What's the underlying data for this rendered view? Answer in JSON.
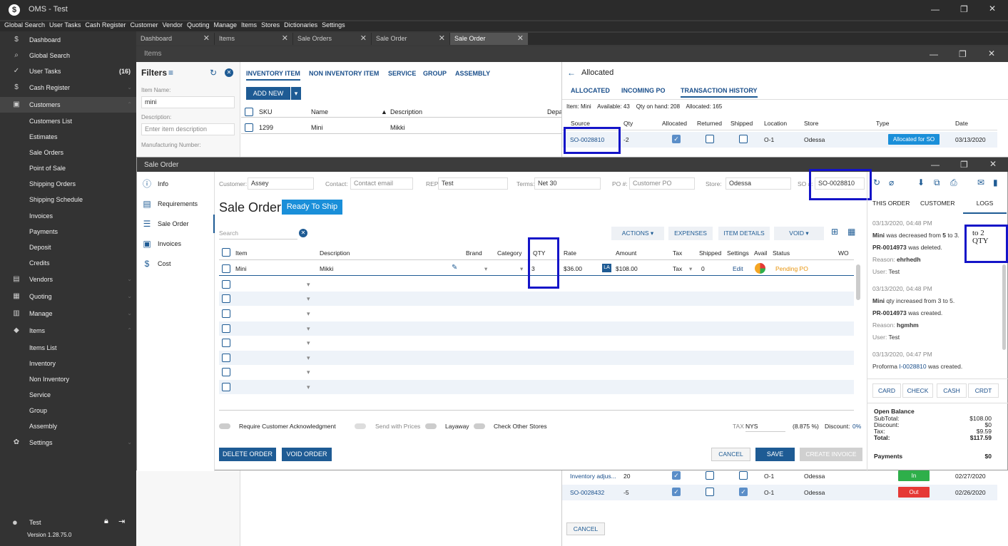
{
  "app": {
    "title": "OMS - Test",
    "logo": "$"
  },
  "menu": [
    "Global Search",
    "User Tasks",
    "Cash Register",
    "Customer",
    "Vendor",
    "Quoting",
    "Manage",
    "Items",
    "Stores",
    "Dictionaries",
    "Settings"
  ],
  "sidebar": {
    "items": [
      {
        "label": "Dashboard",
        "icon": "$"
      },
      {
        "label": "Global Search",
        "icon": "⌕"
      },
      {
        "label": "User Tasks",
        "icon": "✓",
        "count": "(16)"
      },
      {
        "label": "Cash Register",
        "icon": "$"
      },
      {
        "label": "Customers",
        "icon": "▣"
      },
      {
        "label": "Customers List"
      },
      {
        "label": "Estimates"
      },
      {
        "label": "Sale Orders"
      },
      {
        "label": "Point of Sale"
      },
      {
        "label": "Shipping Orders"
      },
      {
        "label": "Shipping Schedule"
      },
      {
        "label": "Invoices"
      },
      {
        "label": "Payments"
      },
      {
        "label": "Deposit"
      },
      {
        "label": "Credits"
      },
      {
        "label": "Vendors",
        "icon": "▤"
      },
      {
        "label": "Quoting",
        "icon": "▦"
      },
      {
        "label": "Manage",
        "icon": "▥"
      },
      {
        "label": "Items",
        "icon": "◆"
      },
      {
        "label": "Items List"
      },
      {
        "label": "Inventory"
      },
      {
        "label": "Non Inventory"
      },
      {
        "label": "Service"
      },
      {
        "label": "Group"
      },
      {
        "label": "Assembly"
      },
      {
        "label": "Settings",
        "icon": "✿"
      }
    ],
    "user": "Test",
    "version": "Version 1.28.75.0"
  },
  "tabs": [
    "Dashboard",
    "Items",
    "Sale Orders",
    "Sale Order",
    "Sale Order"
  ],
  "items_window": {
    "title": "Items",
    "filters": {
      "title": "Filters",
      "item_name_label": "Item Name:",
      "item_name_value": "mini",
      "description_label": "Description:",
      "description_placeholder": "Enter item description",
      "mfg_label": "Manufacturing Number:"
    },
    "type_tabs": [
      "INVENTORY ITEM",
      "NON INVENTORY ITEM",
      "SERVICE",
      "GROUP",
      "ASSEMBLY"
    ],
    "add_new": "ADD NEW",
    "columns": [
      "SKU",
      "Name",
      "Description",
      "Depa"
    ],
    "row": {
      "sku": "1299",
      "name": "Mini",
      "description": "Mikki"
    }
  },
  "allocated_window": {
    "title": "Allocated",
    "tabs": [
      "ALLOCATED",
      "INCOMING PO",
      "TRANSACTION HISTORY"
    ],
    "summary": {
      "item": "Item: Mini",
      "available": "Available: 43",
      "on_hand": "Qty on hand: 208",
      "allocated": "Allocated: 165"
    },
    "columns": [
      "Source",
      "Qty",
      "Allocated",
      "Returned",
      "Shipped",
      "Location",
      "Store",
      "Type",
      "Date"
    ],
    "rows": [
      {
        "source": "SO-0028810",
        "qty": "-2",
        "allocated": true,
        "returned": false,
        "shipped": false,
        "location": "O-1",
        "store": "Odessa",
        "type": "Allocated for SO",
        "date": "03/13/2020"
      },
      {
        "source": "Inventory adjus...",
        "qty": "20",
        "allocated": true,
        "returned": false,
        "shipped": false,
        "location": "O-1",
        "store": "Odessa",
        "type": "In",
        "date": "02/27/2020"
      },
      {
        "source": "SO-0028432",
        "qty": "-5",
        "allocated": true,
        "returned": false,
        "shipped": true,
        "location": "O-1",
        "store": "Odessa",
        "type": "Out",
        "date": "02/26/2020"
      }
    ],
    "cancel": "CANCEL"
  },
  "sale_order": {
    "window_title": "Sale Order",
    "nav": [
      "Info",
      "Requirements",
      "Sale Order",
      "Invoices",
      "Cost"
    ],
    "header": {
      "customer_label": "Customer:",
      "customer": "Assey",
      "contact_label": "Contact:",
      "contact_placeholder": "Contact email",
      "rep_label": "REP:",
      "rep": "Test",
      "terms_label": "Terms:",
      "terms": "Net 30",
      "po_label": "PO #:",
      "po_placeholder": "Customer PO",
      "store_label": "Store:",
      "store": "Odessa",
      "so_label": "SO #:",
      "so": "SO-0028810"
    },
    "title": "Sale Order",
    "status": "Ready To Ship",
    "search_placeholder": "Search",
    "buttons": {
      "actions": "ACTIONS",
      "expenses": "EXPENSES",
      "item_details": "ITEM DETAILS",
      "void": "VOID"
    },
    "columns": [
      "Item",
      "Description",
      "Brand",
      "Category",
      "QTY",
      "Rate",
      "Amount",
      "Tax",
      "Shipped",
      "Settings",
      "Avail",
      "Status",
      "WO"
    ],
    "line": {
      "item": "Mini",
      "description": "Mikki",
      "qty": "3",
      "rate": "$36.00",
      "la": "LA",
      "amount": "$108.00",
      "tax": "Tax",
      "shipped": "0",
      "settings": "Edit",
      "status": "Pending PO"
    },
    "toggles": [
      "Require Customer Acknowledgment",
      "Send with Prices",
      "Layaway",
      "Check Other Stores"
    ],
    "tax_label": "TAX",
    "tax_code": "NYS",
    "tax_rate": "(8.875 %)",
    "discount_label": "Discount:",
    "discount": "0%",
    "footer": {
      "delete": "DELETE ORDER",
      "void": "VOID ORDER",
      "cancel": "CANCEL",
      "save": "SAVE",
      "create_invoice": "CREATE INVOICE"
    },
    "right_tabs": [
      "THIS ORDER",
      "CUSTOMER",
      "LOGS"
    ],
    "logs": [
      {
        "time": "03/13/2020, 04:48 PM",
        "l1a": "Mini",
        "l1b": " was decreased from ",
        "l1c": "5",
        "l1d": " to 3.",
        "l2a": "PR-0014973",
        "l2b": " was deleted.",
        "r_label": "Reason: ",
        "reason": "ehrhedh",
        "u_label": "User: ",
        "user": "Test"
      },
      {
        "time": "03/13/2020, 04:48 PM",
        "l1a": "Mini",
        "l1b": " qty increased from 3 to 5.",
        "l2a": "PR-0014973",
        "l2b": " was created.",
        "r_label": "Reason: ",
        "reason": "hgmhm",
        "u_label": "User: ",
        "user": "Test"
      },
      {
        "time": "03/13/2020, 04:47 PM",
        "l1a": "Proforma ",
        "l1b": "I-0028810",
        "l1c": " was created."
      }
    ],
    "pay_buttons": [
      "CARD",
      "CHECK",
      "CASH",
      "CRDT"
    ],
    "balance": {
      "title": "Open Balance",
      "subtotal_l": "SubTotal:",
      "subtotal": "$108.00",
      "discount_l": "Discount:",
      "discount": "$0",
      "tax_l": "Tax:",
      "tax": "$9.59",
      "total_l": "Total:",
      "total": "$117.59",
      "payments_l": "Payments",
      "payments": "$0"
    },
    "annotation": "to 2\nQTY"
  },
  "colors": {
    "accent": "#1e5b94",
    "status": "#1a8fd9",
    "highlight": "#1414c8",
    "in": "#2eaf4a",
    "out": "#e53935"
  }
}
